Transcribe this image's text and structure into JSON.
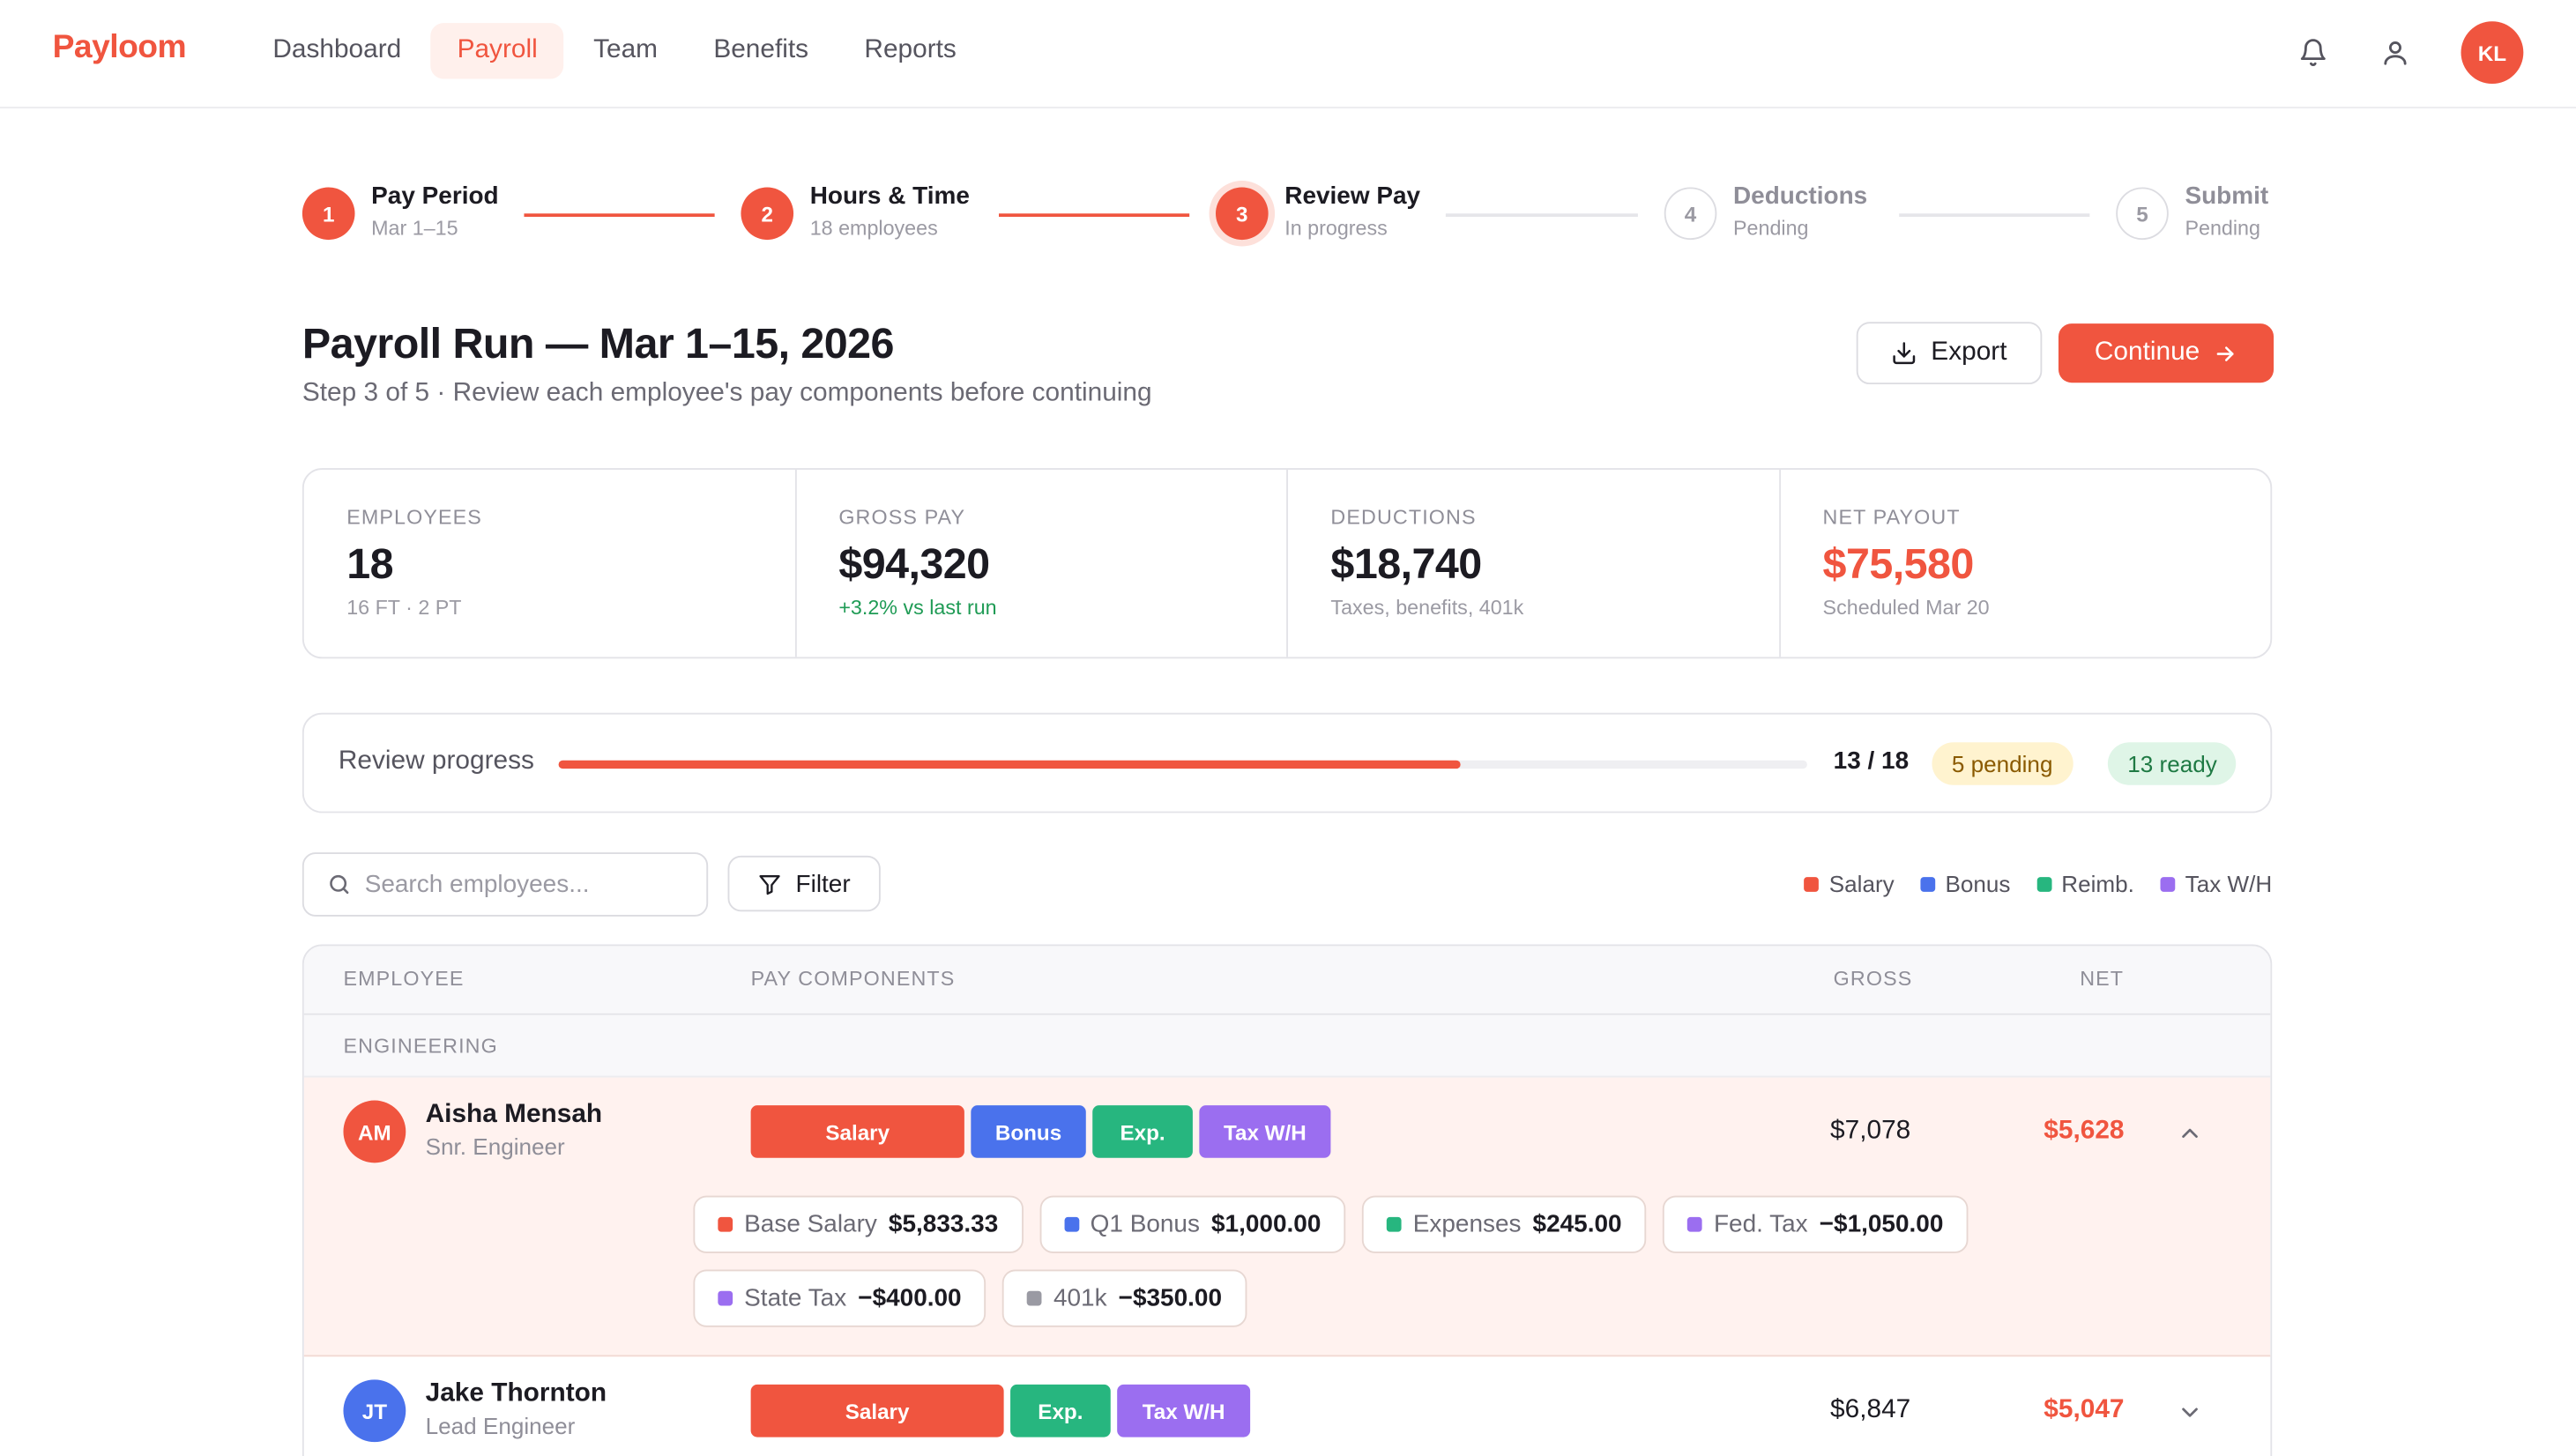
{
  "app": {
    "name": "Payloom",
    "user_initials": "KL"
  },
  "nav": {
    "items": [
      {
        "label": "Dashboard",
        "active": false
      },
      {
        "label": "Payroll",
        "active": true
      },
      {
        "label": "Team",
        "active": false
      },
      {
        "label": "Benefits",
        "active": false
      },
      {
        "label": "Reports",
        "active": false
      }
    ]
  },
  "icons": {
    "bell": "bell-icon",
    "user": "user-icon",
    "download": "download-icon",
    "arrow": "arrow-right-icon",
    "search": "search-icon",
    "filter": "filter-icon",
    "chevron_up": "chevron-up-icon",
    "chevron_down": "chevron-down-icon"
  },
  "stepper": {
    "steps": [
      {
        "number": "1",
        "title": "Pay Period",
        "subtitle": "Mar 1–15",
        "state": "done"
      },
      {
        "number": "2",
        "title": "Hours & Time",
        "subtitle": "18 employees",
        "state": "done"
      },
      {
        "number": "3",
        "title": "Review Pay",
        "subtitle": "In progress",
        "state": "current"
      },
      {
        "number": "4",
        "title": "Deductions",
        "subtitle": "Pending",
        "state": "pending"
      },
      {
        "number": "5",
        "title": "Submit",
        "subtitle": "Pending",
        "state": "pending"
      }
    ]
  },
  "header": {
    "title": "Payroll Run — Mar 1–15, 2026",
    "subtitle": "Step 3 of 5 · Review each employee's pay components before continuing",
    "export_label": "Export",
    "continue_label": "Continue"
  },
  "stats": [
    {
      "label": "Employees",
      "value": "18",
      "note": "16 FT · 2 PT"
    },
    {
      "label": "Gross Pay",
      "value": "$94,320",
      "note": "+3.2% vs last run"
    },
    {
      "label": "Deductions",
      "value": "$18,740",
      "note": "Taxes, benefits, 401k"
    },
    {
      "label": "Net Payout",
      "value": "$75,580",
      "note": "Scheduled Mar 20"
    }
  ],
  "progress": {
    "label": "Review progress",
    "reviewed": 13,
    "total": 18,
    "count_text": "13 / 18",
    "pending_text": "5 pending",
    "ready_text": "13 ready"
  },
  "toolbar": {
    "search_placeholder": "Search employees...",
    "filter_label": "Filter"
  },
  "legend": [
    {
      "label": "Salary",
      "color": "#f0553f"
    },
    {
      "label": "Bonus",
      "color": "#4a72ec"
    },
    {
      "label": "Reimb.",
      "color": "#27b67f"
    },
    {
      "label": "Tax W/H",
      "color": "#9b6ef0"
    }
  ],
  "table": {
    "columns": {
      "employee": "Employee",
      "components": "Pay Components",
      "gross": "Gross",
      "net": "Net"
    },
    "group": "Engineering",
    "rows": [
      {
        "initials": "AM",
        "avatar_color": "#f0553f",
        "name": "Aisha Mensah",
        "role": "Snr. Engineer",
        "gross": "$7,078",
        "net": "$5,628",
        "expanded": true,
        "components": [
          {
            "label": "Salary",
            "color": "#f0553f"
          },
          {
            "label": "Bonus",
            "color": "#4a72ec"
          },
          {
            "label": "Exp.",
            "color": "#27b67f"
          },
          {
            "label": "Tax W/H",
            "color": "#9b6ef0"
          }
        ],
        "details": [
          {
            "label": "Base Salary",
            "amount": "$5,833.33",
            "color": "#f0553f"
          },
          {
            "label": "Q1 Bonus",
            "amount": "$1,000.00",
            "color": "#4a72ec"
          },
          {
            "label": "Expenses",
            "amount": "$245.00",
            "color": "#27b67f"
          },
          {
            "label": "Fed. Tax",
            "amount": "−$1,050.00",
            "color": "#9b6ef0"
          },
          {
            "label": "State Tax",
            "amount": "−$400.00",
            "color": "#9b6ef0"
          },
          {
            "label": "401k",
            "amount": "−$350.00",
            "color": "#9a9aa3"
          }
        ]
      },
      {
        "initials": "JT",
        "avatar_color": "#4a72ec",
        "name": "Jake Thornton",
        "role": "Lead Engineer",
        "gross": "$6,847",
        "net": "$5,047",
        "expanded": false,
        "components": [
          {
            "label": "Salary",
            "color": "#f0553f"
          },
          {
            "label": "Exp.",
            "color": "#27b67f"
          },
          {
            "label": "Tax W/H",
            "color": "#9b6ef0"
          }
        ]
      }
    ]
  }
}
